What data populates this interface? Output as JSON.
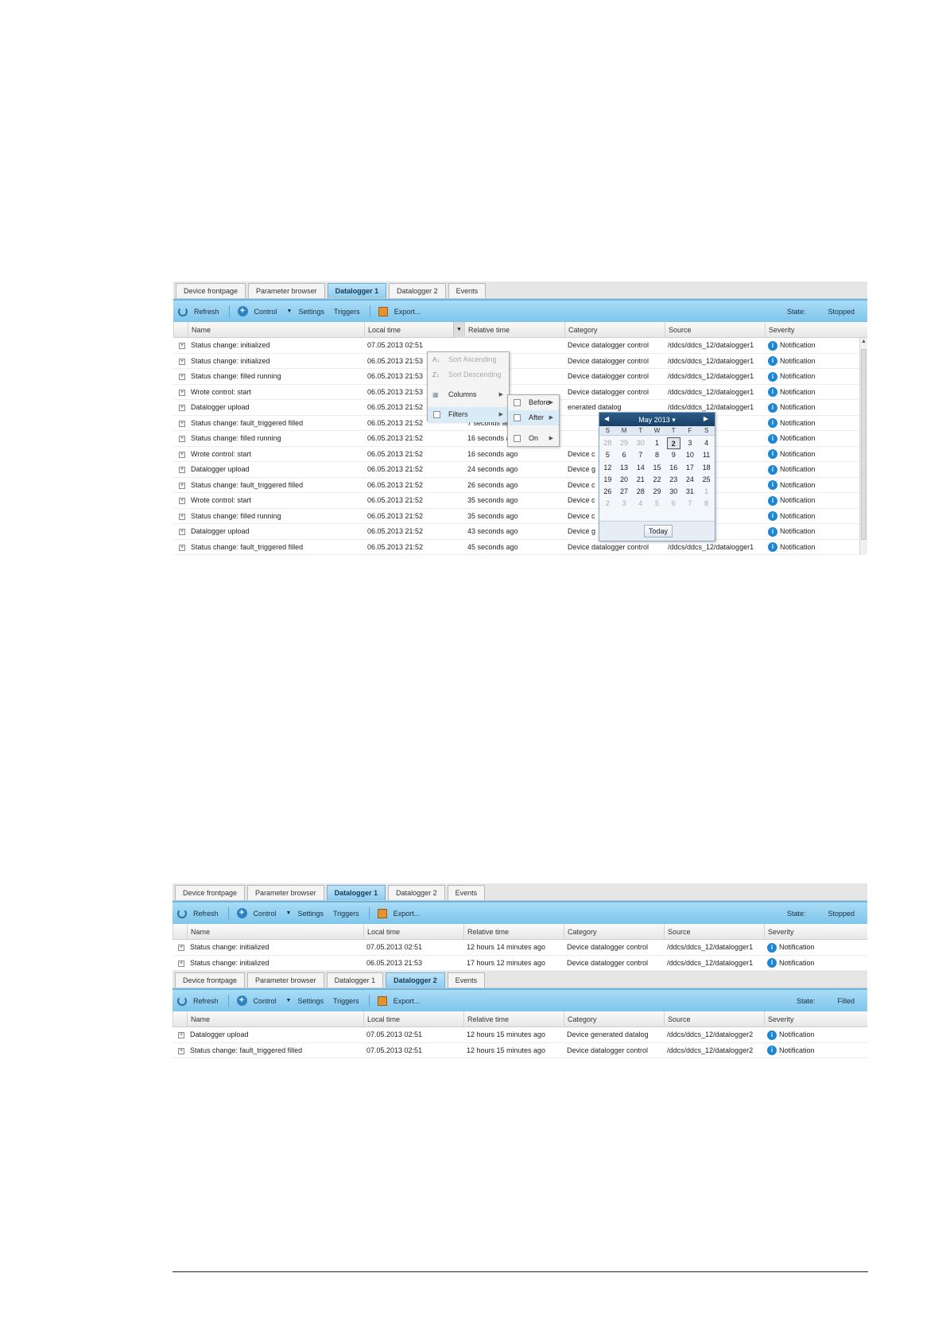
{
  "screenshot1": {
    "tabs": [
      {
        "label": "Device frontpage",
        "active": false
      },
      {
        "label": "Parameter browser",
        "active": false
      },
      {
        "label": "Datalogger 1",
        "active": true
      },
      {
        "label": "Datalogger 2",
        "active": false
      },
      {
        "label": "Events",
        "active": false
      }
    ],
    "toolbar": {
      "refresh": "Refresh",
      "control": "Control",
      "settings": "Settings",
      "triggers": "Triggers",
      "export": "Export...",
      "state_label": "State:",
      "state_value": "Stopped"
    },
    "columns": [
      "Name",
      "Local time",
      "Relative time",
      "Category",
      "Source",
      "Severity"
    ],
    "rows": [
      {
        "name": "Status change: initialized",
        "local": "07.05.2013 02:51",
        "relative": "",
        "category": "Device datalogger control",
        "source": "/ddcs/ddcs_12/datalogger1",
        "severity": "Notification"
      },
      {
        "name": "Status change: initialized",
        "local": "06.05.2013 21:53",
        "relative": "",
        "category": "Device datalogger control",
        "source": "/ddcs/ddcs_12/datalogger1",
        "severity": "Notification"
      },
      {
        "name": "Status change: filled running",
        "local": "06.05.2013 21:53",
        "relative": "",
        "category": "Device datalogger control",
        "source": "/ddcs/ddcs_12/datalogger1",
        "severity": "Notification"
      },
      {
        "name": "Wrote control: start",
        "local": "06.05.2013 21:53",
        "relative": "",
        "category": "Device datalogger control",
        "source": "/ddcs/ddcs_12/datalogger1",
        "severity": "Notification"
      },
      {
        "name": "Datalogger upload",
        "local": "06.05.2013 21:52",
        "relative": "",
        "category": "enerated datalog",
        "source": "/ddcs/ddcs_12/datalogger1",
        "severity": "Notification"
      },
      {
        "name": "Status change: fault_triggered filled",
        "local": "06.05.2013 21:52",
        "relative": "7 seconds ago",
        "category": "",
        "source": "/datalogger1",
        "severity": "Notification"
      },
      {
        "name": "Status change: filled running",
        "local": "06.05.2013 21:52",
        "relative": "16 seconds ago",
        "category": "",
        "source": "/datalogger1",
        "severity": "Notification"
      },
      {
        "name": "Wrote control: start",
        "local": "06.05.2013 21:52",
        "relative": "16 seconds ago",
        "category": "Device c",
        "source": "/datalogger1",
        "severity": "Notification"
      },
      {
        "name": "Datalogger upload",
        "local": "06.05.2013 21:52",
        "relative": "24 seconds ago",
        "category": "Device g",
        "source": "/datalogger1",
        "severity": "Notification"
      },
      {
        "name": "Status change: fault_triggered filled",
        "local": "06.05.2013 21:52",
        "relative": "26 seconds ago",
        "category": "Device c",
        "source": "/datalogger1",
        "severity": "Notification"
      },
      {
        "name": "Wrote control: start",
        "local": "06.05.2013 21:52",
        "relative": "35 seconds ago",
        "category": "Device c",
        "source": "/datalogger1",
        "severity": "Notification"
      },
      {
        "name": "Status change: filled running",
        "local": "06.05.2013 21:52",
        "relative": "35 seconds ago",
        "category": "Device c",
        "source": "/datalogger1",
        "severity": "Notification"
      },
      {
        "name": "Datalogger upload",
        "local": "06.05.2013 21:52",
        "relative": "43 seconds ago",
        "category": "Device g",
        "source": "/datalogger1",
        "severity": "Notification"
      },
      {
        "name": "Status change: fault_triggered filled",
        "local": "06.05.2013 21:52",
        "relative": "45 seconds ago",
        "category": "Device datalogger control",
        "source": "/ddcs/ddcs_12/datalogger1",
        "severity": "Notification"
      }
    ],
    "column_menu": {
      "sort_ascending": "Sort Ascending",
      "sort_descending": "Sort Descending",
      "columns": "Columns",
      "filters": "Filters"
    },
    "filter_menu": {
      "before": "Before",
      "after": "After",
      "on": "On"
    },
    "calendar": {
      "month_label": "May 2013",
      "day_names": [
        "S",
        "M",
        "T",
        "W",
        "T",
        "F",
        "S"
      ],
      "days": [
        {
          "d": "28",
          "other": true
        },
        {
          "d": "29",
          "other": true
        },
        {
          "d": "30",
          "other": true
        },
        {
          "d": "1"
        },
        {
          "d": "2",
          "selected": true
        },
        {
          "d": "3"
        },
        {
          "d": "4"
        },
        {
          "d": "5"
        },
        {
          "d": "6"
        },
        {
          "d": "7"
        },
        {
          "d": "8"
        },
        {
          "d": "9"
        },
        {
          "d": "10"
        },
        {
          "d": "11"
        },
        {
          "d": "12"
        },
        {
          "d": "13"
        },
        {
          "d": "14"
        },
        {
          "d": "15"
        },
        {
          "d": "16"
        },
        {
          "d": "17"
        },
        {
          "d": "18"
        },
        {
          "d": "19"
        },
        {
          "d": "20"
        },
        {
          "d": "21"
        },
        {
          "d": "22"
        },
        {
          "d": "23"
        },
        {
          "d": "24"
        },
        {
          "d": "25"
        },
        {
          "d": "26"
        },
        {
          "d": "27"
        },
        {
          "d": "28"
        },
        {
          "d": "29"
        },
        {
          "d": "30"
        },
        {
          "d": "31"
        },
        {
          "d": "1",
          "other": true
        },
        {
          "d": "2",
          "other": true
        },
        {
          "d": "3",
          "other": true
        },
        {
          "d": "4",
          "other": true
        },
        {
          "d": "5",
          "other": true
        },
        {
          "d": "6",
          "other": true
        },
        {
          "d": "7",
          "other": true
        },
        {
          "d": "8",
          "other": true
        }
      ],
      "today": "Today"
    }
  },
  "screenshot2": {
    "panel1": {
      "tabs": [
        {
          "label": "Device frontpage",
          "active": false
        },
        {
          "label": "Parameter browser",
          "active": false
        },
        {
          "label": "Datalogger 1",
          "active": true
        },
        {
          "label": "Datalogger 2",
          "active": false
        },
        {
          "label": "Events",
          "active": false
        }
      ],
      "toolbar": {
        "refresh": "Refresh",
        "control": "Control",
        "settings": "Settings",
        "triggers": "Triggers",
        "export": "Export...",
        "state_label": "State:",
        "state_value": "Stopped"
      },
      "columns": [
        "Name",
        "Local time",
        "Relative time",
        "Category",
        "Source",
        "Severity"
      ],
      "rows": [
        {
          "name": "Status change: initialized",
          "local": "07.05.2013 02:51",
          "relative": "12 hours 14 minutes ago",
          "category": "Device datalogger control",
          "source": "/ddcs/ddcs_12/datalogger1",
          "severity": "Notification"
        },
        {
          "name": "Status change: initialized",
          "local": "06.05.2013 21:53",
          "relative": "17 hours 12 minutes ago",
          "category": "Device datalogger control",
          "source": "/ddcs/ddcs_12/datalogger1",
          "severity": "Notification"
        }
      ]
    },
    "panel2": {
      "tabs": [
        {
          "label": "Device frontpage",
          "active": false
        },
        {
          "label": "Parameter browser",
          "active": false
        },
        {
          "label": "Datalogger 1",
          "active": false
        },
        {
          "label": "Datalogger 2",
          "active": true
        },
        {
          "label": "Events",
          "active": false
        }
      ],
      "toolbar": {
        "refresh": "Refresh",
        "control": "Control",
        "settings": "Settings",
        "triggers": "Triggers",
        "export": "Export...",
        "state_label": "State:",
        "state_value": "Filled"
      },
      "columns": [
        "Name",
        "Local time",
        "Relative time",
        "Category",
        "Source",
        "Severity"
      ],
      "rows": [
        {
          "name": "Datalogger upload",
          "local": "07.05.2013 02:51",
          "relative": "12 hours 15 minutes ago",
          "category": "Device generated datalog",
          "source": "/ddcs/ddcs_12/datalogger2",
          "severity": "Notification"
        },
        {
          "name": "Status change: fault_triggered filled",
          "local": "07.05.2013 02:51",
          "relative": "12 hours 15 minutes ago",
          "category": "Device datalogger control",
          "source": "/ddcs/ddcs_12/datalogger2",
          "severity": "Notification"
        }
      ]
    }
  }
}
